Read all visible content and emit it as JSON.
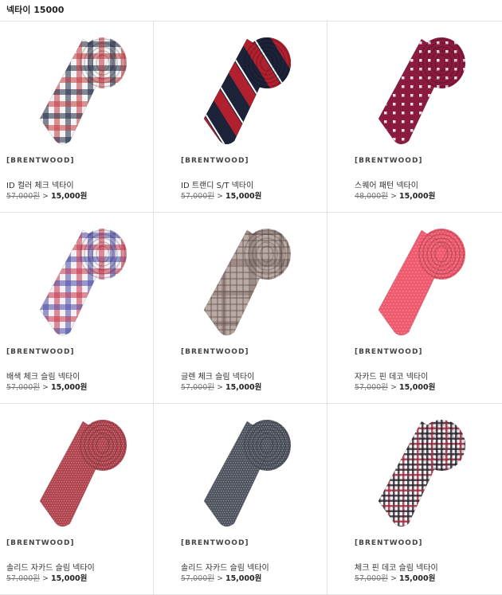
{
  "header": {
    "title": "넥타이 15000"
  },
  "products": [
    {
      "brand": "[BRENTWOOD]",
      "name": "ID 컬러 체크 넥타이",
      "original_price": "57,000원",
      "arrow": ">",
      "sale_price": "15,000원",
      "pattern": "gingham",
      "colors": [
        "#f4f4f4",
        "#1f2a44",
        "#c23b3f"
      ]
    },
    {
      "brand": "[BRENTWOOD]",
      "name": "ID 트랜디 S/T 넥타이",
      "original_price": "57,000원",
      "arrow": ">",
      "sale_price": "15,000원",
      "pattern": "stripe",
      "colors": [
        "#1c2338",
        "#b0202e",
        "#ffffff"
      ]
    },
    {
      "brand": "[BRENTWOOD]",
      "name": "스퀘어 패턴 넥타이",
      "original_price": "48,000원",
      "arrow": ">",
      "sale_price": "15,000원",
      "pattern": "dots",
      "colors": [
        "#8a1a3e",
        "#f2dfe7"
      ]
    },
    {
      "brand": "[BRENTWOOD]",
      "name": "배색 체크 슬림 넥타이",
      "original_price": "57,000원",
      "arrow": ">",
      "sale_price": "15,000원",
      "pattern": "gingham",
      "colors": [
        "#f4f0f4",
        "#4c4fa6",
        "#c9364a"
      ]
    },
    {
      "brand": "[BRENTWOOD]",
      "name": "글렌 체크 슬림 넥타이",
      "original_price": "57,000원",
      "arrow": ">",
      "sale_price": "15,000원",
      "pattern": "glen",
      "colors": [
        "#b9a9a3",
        "#6b5552"
      ]
    },
    {
      "brand": "[BRENTWOOD]",
      "name": "자카드 핀 데코 넥타이",
      "original_price": "57,000원",
      "arrow": ">",
      "sale_price": "15,000원",
      "pattern": "solid",
      "colors": [
        "#ef5a6e",
        "#f7a0ad"
      ]
    },
    {
      "brand": "[BRENTWOOD]",
      "name": "솔리드 자카드 슬림 넥타이",
      "original_price": "57,000원",
      "arrow": ">",
      "sale_price": "15,000원",
      "pattern": "micro",
      "colors": [
        "#b0454f",
        "#d98e95"
      ]
    },
    {
      "brand": "[BRENTWOOD]",
      "name": "솔리드 자카드 슬림 넥타이",
      "original_price": "57,000원",
      "arrow": ">",
      "sale_price": "15,000원",
      "pattern": "micro",
      "colors": [
        "#50545e",
        "#9ea2ab"
      ]
    },
    {
      "brand": "[BRENTWOOD]",
      "name": "체크 핀 데코 슬림 넥타이",
      "original_price": "57,000원",
      "arrow": ">",
      "sale_price": "15,000원",
      "pattern": "smallcheck",
      "colors": [
        "#f4f4f4",
        "#2a1f2a",
        "#a0243a"
      ]
    }
  ]
}
